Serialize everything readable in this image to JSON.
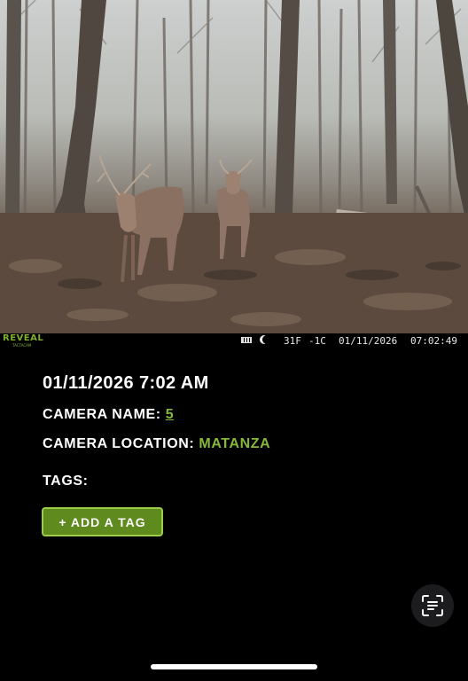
{
  "photo": {
    "stamp": {
      "brand": "REVEAL",
      "brand_sub": "TACTACAM",
      "battery_icon": "battery-icon",
      "moon_icon": "moon-phase-icon",
      "temp_f": "31F",
      "temp_c": "-1C",
      "date": "01/11/2026",
      "time": "07:02:49"
    }
  },
  "details": {
    "datetime": "01/11/2026 7:02 AM",
    "camera_name_label": "CAMERA NAME:",
    "camera_name_value": "5",
    "camera_location_label": "CAMERA LOCATION:",
    "camera_location_value": "MATANZA",
    "tags_label": "TAGS:",
    "add_tag_label": "+ ADD A TAG"
  },
  "scan_button": {
    "icon": "text-scan-icon"
  },
  "colors": {
    "accent_green": "#86b83a",
    "button_green": "#5e8a1e",
    "button_border": "#9ccc4a",
    "background": "#000000"
  }
}
